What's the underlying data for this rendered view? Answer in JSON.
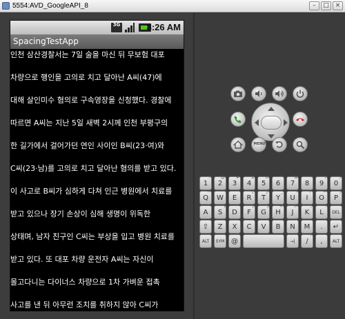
{
  "window": {
    "title": "5554:AVD_GoogleAPI_8",
    "buttons": [
      "–",
      "□",
      "×"
    ]
  },
  "device": {
    "status_bar": {
      "network_type": "3G",
      "time": "8:26 AM",
      "icons": [
        "network-3g-icon",
        "signal-strength-icon",
        "battery-icon"
      ]
    },
    "app_title": "SpacingTestApp",
    "paragraphs": [
      "인천 삼산경찰서는 7일 술을 마신 뒤 무보험 대포",
      "차량으로 행인을 고의로 치고 달아난 A씨(47)에",
      "대해 살인미수 혐의로 구속영장을 신청했다. 경찰에",
      "따르면 A씨는 지난 5일 새벽 2시께 인천 부평구의",
      "한 길가에서 걸어가던 연인 사이인 B씨(23·여)와",
      "C씨(23·남)를 고의로 치고 달아난 혐의를 받고 있다.",
      "이 사고로 B씨가 심하게 다쳐 인근 병원에서 치료를",
      "받고 있으나 장기 손상이 심해 생명이 위독한",
      "상태며, 남자 친구인 C씨는 부상을 입고 병원 치료를",
      "받고 있다. 또 대포 차량 운전자 A씨는 자신이",
      "몰고다니는 다이너스 차량으로 1차 가벼운 접촉",
      "사고를 낸 뒤 아무런 조치를 취하지 않아 C씨가"
    ]
  },
  "controls": {
    "top_row": [
      "camera-icon",
      "volume-down-icon",
      "volume-up-icon",
      "power-icon"
    ],
    "call": "call-icon",
    "end_call": "end-call-icon",
    "bottom_row": [
      "home-icon",
      "menu-icon",
      "back-icon",
      "search-icon"
    ],
    "menu_label": "MENU"
  },
  "keyboard": {
    "rows": [
      [
        {
          "label": "1",
          "alt": "!"
        },
        {
          "label": "2",
          "alt": "@"
        },
        {
          "label": "3",
          "alt": "#"
        },
        {
          "label": "4",
          "alt": "$"
        },
        {
          "label": "5",
          "alt": "%"
        },
        {
          "label": "6",
          "alt": "^"
        },
        {
          "label": "7",
          "alt": "&"
        },
        {
          "label": "8",
          "alt": "*"
        },
        {
          "label": "9",
          "alt": "("
        },
        {
          "label": "0",
          "alt": ")"
        }
      ],
      [
        {
          "label": "Q",
          "alt": "~"
        },
        {
          "label": "W",
          "alt": "\""
        },
        {
          "label": "E",
          "alt": "`"
        },
        {
          "label": "R",
          "alt": "{"
        },
        {
          "label": "T",
          "alt": "}"
        },
        {
          "label": "Y",
          "alt": "_"
        },
        {
          "label": "U",
          "alt": "-"
        },
        {
          "label": "I",
          "alt": "+"
        },
        {
          "label": "O",
          "alt": "="
        },
        {
          "label": "P",
          "alt": "|"
        }
      ],
      [
        {
          "label": "A",
          "alt": ""
        },
        {
          "label": "S",
          "alt": "\\"
        },
        {
          "label": "D",
          "alt": "'"
        },
        {
          "label": "F",
          "alt": "["
        },
        {
          "label": "G",
          "alt": "]"
        },
        {
          "label": "H",
          "alt": "<"
        },
        {
          "label": "J",
          "alt": ">"
        },
        {
          "label": "K",
          "alt": ";"
        },
        {
          "label": "L",
          "alt": ":"
        },
        {
          "label": "DEL",
          "alt": ""
        }
      ],
      [
        {
          "label": "⇧",
          "alt": ""
        },
        {
          "label": "Z",
          "alt": ""
        },
        {
          "label": "X",
          "alt": ""
        },
        {
          "label": "C",
          "alt": ""
        },
        {
          "label": "V",
          "alt": ""
        },
        {
          "label": "B",
          "alt": ""
        },
        {
          "label": "N",
          "alt": ""
        },
        {
          "label": "M",
          "alt": ""
        },
        {
          "label": ".",
          "alt": ""
        },
        {
          "label": "↵",
          "alt": ""
        }
      ],
      [
        {
          "label": "ALT",
          "alt": ""
        },
        {
          "label": "SYM",
          "alt": ""
        },
        {
          "label": "@",
          "alt": ""
        },
        {
          "label": "",
          "alt": ""
        },
        {
          "label": "→|",
          "alt": ""
        },
        {
          "label": "/",
          "alt": "?"
        },
        {
          "label": ",",
          "alt": ""
        },
        {
          "label": "ALT",
          "alt": ""
        }
      ]
    ]
  }
}
